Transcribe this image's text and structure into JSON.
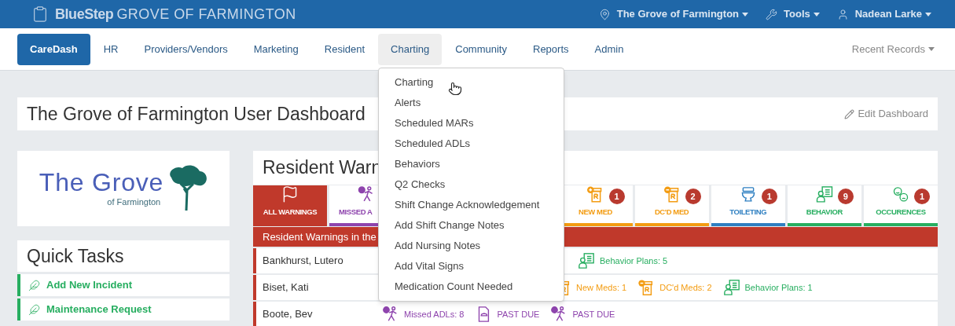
{
  "top_bar": {
    "brand": "BlueStep",
    "site": "GROVE OF FARMINGTON",
    "menus": [
      {
        "kind": "location",
        "label": "The Grove of Farmington"
      },
      {
        "kind": "tools",
        "label": "Tools"
      },
      {
        "kind": "user",
        "label": "Nadean Larke"
      }
    ]
  },
  "nav": {
    "items": [
      {
        "label": "CareDash",
        "selected": true,
        "open": false
      },
      {
        "label": "HR",
        "selected": false,
        "open": false
      },
      {
        "label": "Providers/Vendors",
        "selected": false,
        "open": false
      },
      {
        "label": "Marketing",
        "selected": false,
        "open": false
      },
      {
        "label": "Resident",
        "selected": false,
        "open": false
      },
      {
        "label": "Charting",
        "selected": false,
        "open": true
      },
      {
        "label": "Community",
        "selected": false,
        "open": false
      },
      {
        "label": "Reports",
        "selected": false,
        "open": false
      },
      {
        "label": "Admin",
        "selected": false,
        "open": false
      }
    ],
    "recent": "Recent Records",
    "dropdown": [
      "Charting",
      "Alerts",
      "Scheduled MARs",
      "Scheduled ADLs",
      "Behaviors",
      "Q2 Checks",
      "Shift Change Acknowledgement",
      "Add Shift Change Notes",
      "Add Nursing Notes",
      "Add Vital Signs",
      "Medication Count Needed"
    ]
  },
  "dashboard_title": "The Grove of Farmington User Dashboard",
  "edit_dashboard": "Edit Dashboard",
  "logo": {
    "name": "The Grove",
    "sub": "of Farmington"
  },
  "quick_tasks": {
    "title": "Quick Tasks",
    "items": [
      "Add New Incident",
      "Maintenance Request"
    ]
  },
  "warnings": {
    "title": "Resident Warn",
    "tabs": [
      {
        "kind": "all",
        "label": "ALL WARNINGS",
        "selected": true,
        "color": "#c0392b"
      },
      {
        "kind": "missed_adl",
        "label": "MISSED A",
        "selected": false,
        "color": "#8e44ad"
      },
      {
        "kind": "new_med",
        "label": "NEW MED",
        "count": "1",
        "selected": false,
        "color": "#f39c12"
      },
      {
        "kind": "dc_med",
        "label": "DC'D MED",
        "count": "2",
        "selected": false,
        "color": "#f39c12"
      },
      {
        "kind": "toileting",
        "label": "TOILETING",
        "count": "1",
        "selected": false,
        "color": "#2e7fc1"
      },
      {
        "kind": "behavior",
        "label": "BEHAVIOR",
        "count": "9",
        "selected": false,
        "color": "#27ae60"
      },
      {
        "kind": "occurences",
        "label": "OCCURENCES",
        "count": "1",
        "selected": false,
        "color": "#27ae60"
      }
    ],
    "banner": "Resident Warnings in the",
    "rows": [
      {
        "name": "Bankhurst, Lutero",
        "items": [
          {
            "kind": "behavior",
            "text": "Behavior Plans: 5"
          }
        ]
      },
      {
        "name": "Biset, Kati",
        "items": [
          {
            "kind": "new_med",
            "text": "New Meds: 1"
          },
          {
            "kind": "dc_med",
            "text": "DC'd Meds: 2"
          },
          {
            "kind": "behavior",
            "text": "Behavior Plans: 1"
          }
        ]
      },
      {
        "name": "Boote, Bev",
        "items": [
          {
            "kind": "missed_adl",
            "text": "Missed ADLs: 8"
          },
          {
            "kind": "past_due_doc",
            "text": "PAST DUE"
          },
          {
            "kind": "past_due_adl",
            "text": "PAST DUE"
          }
        ]
      }
    ]
  }
}
